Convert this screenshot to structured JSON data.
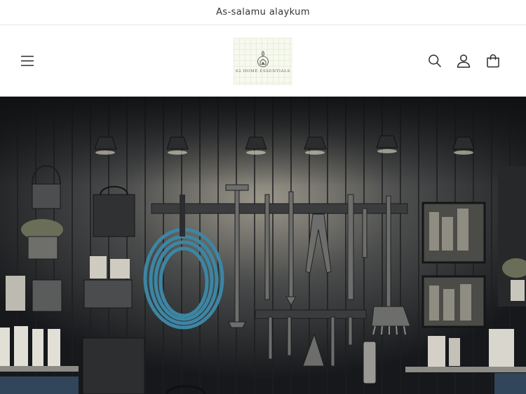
{
  "announcement": {
    "text": "As-salamu alaykum"
  },
  "header": {
    "logo_text": "62 HOME ESSENTIALS",
    "icons": {
      "menu": "hamburger-menu-icon",
      "search": "search-icon",
      "account": "account-icon",
      "cart": "cart-icon"
    }
  },
  "hero": {
    "image": "garage-tool-wall-illustration",
    "colors": {
      "hose": "#3c86a4",
      "wall": "#34373b"
    }
  }
}
